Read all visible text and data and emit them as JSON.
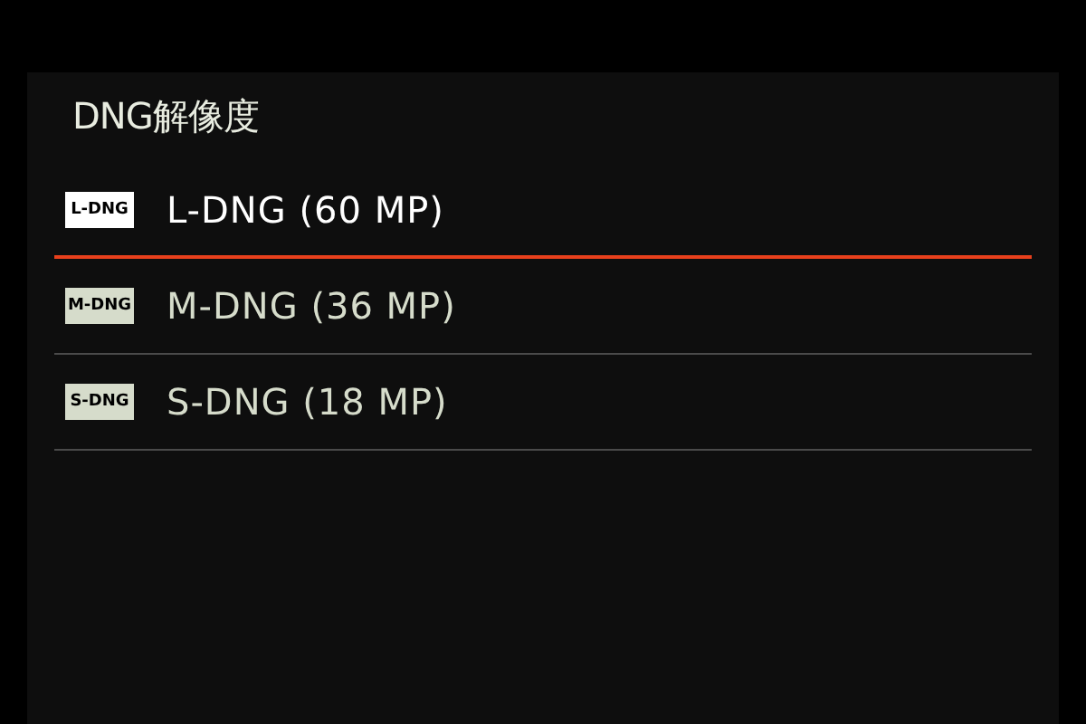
{
  "title": "DNG解像度",
  "options": [
    {
      "badge": "L-DNG",
      "label": "L-DNG (60 MP)",
      "selected": true
    },
    {
      "badge": "M-DNG",
      "label": "M-DNG (36 MP)",
      "selected": false
    },
    {
      "badge": "S-DNG",
      "label": "S-DNG (18 MP)",
      "selected": false
    }
  ]
}
